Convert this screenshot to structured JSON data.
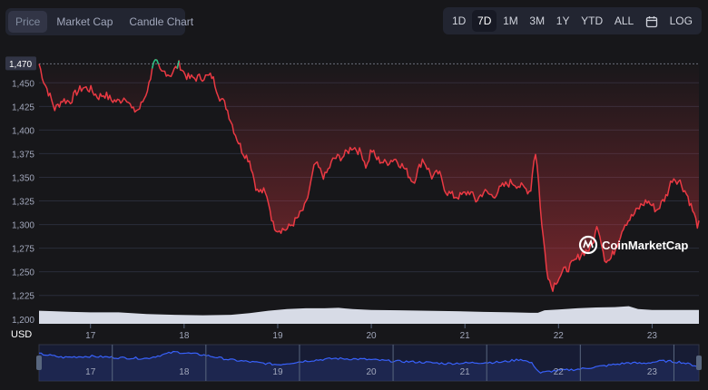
{
  "view_tabs": [
    {
      "label": "Price",
      "active": true
    },
    {
      "label": "Market Cap",
      "active": false
    },
    {
      "label": "Candle Chart",
      "active": false
    }
  ],
  "time_ranges": [
    {
      "label": "1D",
      "active": false
    },
    {
      "label": "7D",
      "active": true
    },
    {
      "label": "1M",
      "active": false
    },
    {
      "label": "3M",
      "active": false
    },
    {
      "label": "1Y",
      "active": false
    },
    {
      "label": "YTD",
      "active": false
    },
    {
      "label": "ALL",
      "active": false
    }
  ],
  "calendar_icon": "calendar-icon",
  "log_label": "LOG",
  "watermark": "CoinMarketCap",
  "colors": {
    "price_down": "#ea3943",
    "price_up": "#16c784",
    "volume": "#d7dbe6",
    "navigator_line": "#3861fb"
  },
  "chart_data": {
    "type": "line",
    "currency_label": "USD",
    "current_price_label": "1,470",
    "reference_value": 1470,
    "ylim": [
      1195,
      1480
    ],
    "y_ticks": [
      1200,
      1225,
      1250,
      1275,
      1300,
      1325,
      1350,
      1375,
      1400,
      1425,
      1450
    ],
    "y_tick_labels": [
      "1,200",
      "1,225",
      "1,250",
      "1,275",
      "1,300",
      "1,325",
      "1,350",
      "1,375",
      "1,400",
      "1,425",
      "1,450"
    ],
    "xlim": [
      16.45,
      23.5
    ],
    "x_ticks": [
      17,
      18,
      19,
      20,
      21,
      22,
      23
    ],
    "x_tick_labels": [
      "17",
      "18",
      "19",
      "20",
      "21",
      "22",
      "23"
    ],
    "grid": true,
    "series": [
      {
        "values_x": [
          16.45,
          16.5,
          16.55,
          16.62,
          16.7,
          16.78,
          16.85,
          16.92,
          17.0,
          17.08,
          17.15,
          17.22,
          17.3,
          17.38,
          17.45,
          17.52,
          17.58,
          17.63,
          17.66,
          17.7,
          17.75,
          17.8,
          17.85,
          17.9,
          17.95,
          18.0,
          18.05,
          18.12,
          18.2,
          18.3,
          18.38,
          18.45,
          18.55,
          18.62,
          18.7,
          18.78,
          18.85,
          18.9,
          18.95,
          19.0,
          19.1,
          19.2,
          19.3,
          19.4,
          19.5,
          19.6,
          19.7,
          19.8,
          19.9,
          19.95,
          20.0,
          20.05,
          20.15,
          20.25,
          20.35,
          20.45,
          20.55,
          20.65,
          20.72,
          20.8,
          20.88,
          20.95,
          21.05,
          21.12,
          21.2,
          21.3,
          21.4,
          21.5,
          21.6,
          21.7,
          21.75,
          21.78,
          21.82,
          21.88,
          21.93,
          21.97,
          22.05,
          22.15,
          22.25,
          22.35,
          22.42,
          22.5,
          22.55,
          22.62,
          22.7,
          22.8,
          22.88,
          22.95,
          23.05,
          23.15,
          23.22,
          23.3,
          23.38,
          23.45,
          23.48
        ],
        "values_y": [
          1470,
          1452,
          1440,
          1422,
          1432,
          1430,
          1440,
          1445,
          1443,
          1435,
          1438,
          1432,
          1430,
          1436,
          1420,
          1422,
          1435,
          1450,
          1468,
          1472,
          1460,
          1462,
          1458,
          1464,
          1470,
          1460,
          1455,
          1455,
          1456,
          1457,
          1435,
          1425,
          1395,
          1378,
          1368,
          1335,
          1335,
          1325,
          1300,
          1295,
          1295,
          1305,
          1320,
          1365,
          1350,
          1370,
          1372,
          1383,
          1375,
          1360,
          1380,
          1370,
          1365,
          1370,
          1360,
          1345,
          1370,
          1350,
          1355,
          1335,
          1330,
          1330,
          1335,
          1325,
          1335,
          1330,
          1340,
          1345,
          1340,
          1335,
          1380,
          1355,
          1300,
          1250,
          1232,
          1240,
          1250,
          1258,
          1270,
          1275,
          1300,
          1262,
          1262,
          1278,
          1300,
          1310,
          1320,
          1325,
          1315,
          1330,
          1350,
          1345,
          1330,
          1310,
          1300
        ]
      }
    ],
    "volume": {
      "x": [
        16.45,
        16.6,
        16.8,
        17.0,
        17.3,
        17.6,
        17.9,
        18.2,
        18.5,
        18.7,
        18.9,
        19.1,
        19.3,
        19.5,
        19.65,
        19.8,
        20.0,
        20.3,
        20.6,
        20.9,
        21.2,
        21.5,
        21.7,
        21.78,
        21.85,
        22.0,
        22.2,
        22.4,
        22.6,
        22.75,
        22.85,
        23.0,
        23.2,
        23.5
      ],
      "level": [
        0.32,
        0.31,
        0.29,
        0.28,
        0.28,
        0.24,
        0.22,
        0.21,
        0.22,
        0.26,
        0.32,
        0.36,
        0.38,
        0.38,
        0.39,
        0.36,
        0.34,
        0.33,
        0.32,
        0.31,
        0.29,
        0.28,
        0.27,
        0.27,
        0.33,
        0.35,
        0.38,
        0.4,
        0.41,
        0.43,
        0.36,
        0.34,
        0.34,
        0.34
      ]
    },
    "navigator": {
      "x": [
        16.45,
        16.7,
        17.0,
        17.3,
        17.6,
        17.9,
        18.2,
        18.5,
        18.8,
        19.0,
        19.3,
        19.6,
        19.9,
        20.2,
        20.5,
        20.8,
        21.1,
        21.4,
        21.6,
        21.72,
        21.8,
        21.95,
        22.2,
        22.5,
        22.75,
        22.9,
        23.1,
        23.3,
        23.5
      ],
      "level": [
        0.75,
        0.65,
        0.68,
        0.64,
        0.62,
        0.8,
        0.72,
        0.58,
        0.5,
        0.45,
        0.55,
        0.62,
        0.6,
        0.55,
        0.52,
        0.48,
        0.5,
        0.52,
        0.6,
        0.48,
        0.22,
        0.28,
        0.32,
        0.42,
        0.5,
        0.48,
        0.55,
        0.52,
        0.4
      ]
    }
  }
}
